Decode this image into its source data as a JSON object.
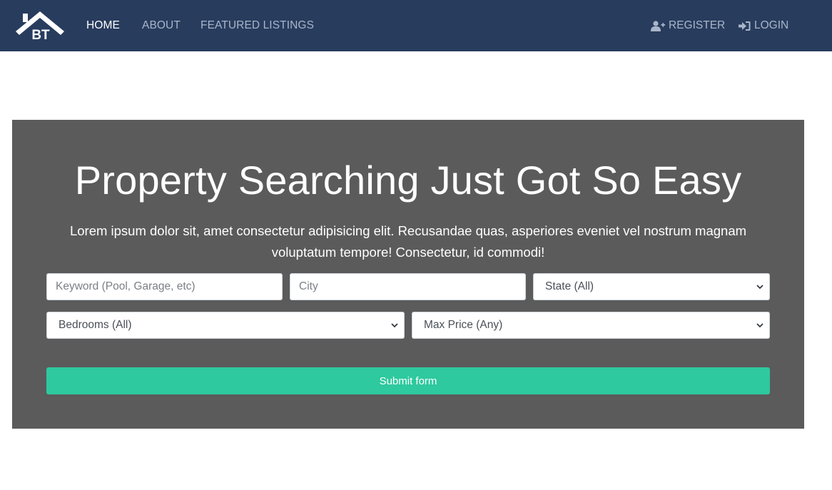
{
  "nav": {
    "logo_text": "BT",
    "links": [
      {
        "label": "HOME"
      },
      {
        "label": "ABOUT"
      },
      {
        "label": "FEATURED LISTINGS"
      }
    ],
    "register_label": "REGISTER",
    "login_label": "LOGIN",
    "register_icon": "user-plus-icon",
    "login_icon": "sign-in-icon"
  },
  "showcase": {
    "title": "Property Searching Just Got So Easy",
    "text": "Lorem ipsum dolor sit, amet consectetur adipisicing elit. Recusandae quas, asperiores eveniet vel nostrum magnam voluptatum tempore! Consectetur, id commodi!"
  },
  "search": {
    "keyword_placeholder": "Keyword (Pool, Garage, etc)",
    "city_placeholder": "City",
    "state_selected": "State (All)",
    "bedrooms_selected": "Bedrooms (All)",
    "max_price_selected": "Max Price (Any)",
    "submit_label": "Submit form"
  },
  "colors": {
    "navbar": "#283c5e",
    "showcase_bg": "#5b5b5b",
    "submit": "#2ec99e"
  }
}
